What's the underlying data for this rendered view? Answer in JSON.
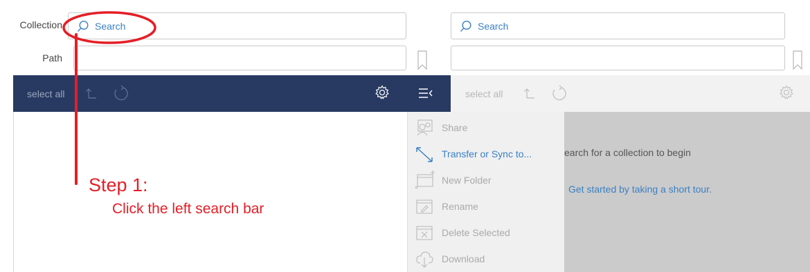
{
  "left_panel": {
    "collection_label": "Collection",
    "path_label": "Path",
    "search_placeholder": "Search",
    "path_value": "",
    "select_all": "select all"
  },
  "right_panel": {
    "search_placeholder": "Search",
    "path_value": "",
    "select_all": "select all",
    "empty_message": "earch for a collection to begin",
    "tour_link": "Get started by taking a short tour."
  },
  "menu": {
    "items": [
      {
        "label": "Share",
        "icon": "share-icon",
        "enabled": false
      },
      {
        "label": "Transfer or Sync to...",
        "icon": "transfer-arrow-icon",
        "enabled": true
      },
      {
        "label": "New Folder",
        "icon": "new-folder-icon",
        "enabled": false
      },
      {
        "label": "Rename",
        "icon": "rename-icon",
        "enabled": false
      },
      {
        "label": "Delete Selected",
        "icon": "delete-icon",
        "enabled": false
      },
      {
        "label": "Download",
        "icon": "download-icon",
        "enabled": false
      }
    ]
  },
  "annotation": {
    "step_title": "Step 1:",
    "step_desc": "Click the left search bar",
    "color": "#e41e26"
  },
  "colors": {
    "toolbar_dark": "#283a62",
    "link_blue": "#3a80c4",
    "panel_gray": "#cbcbcb"
  }
}
